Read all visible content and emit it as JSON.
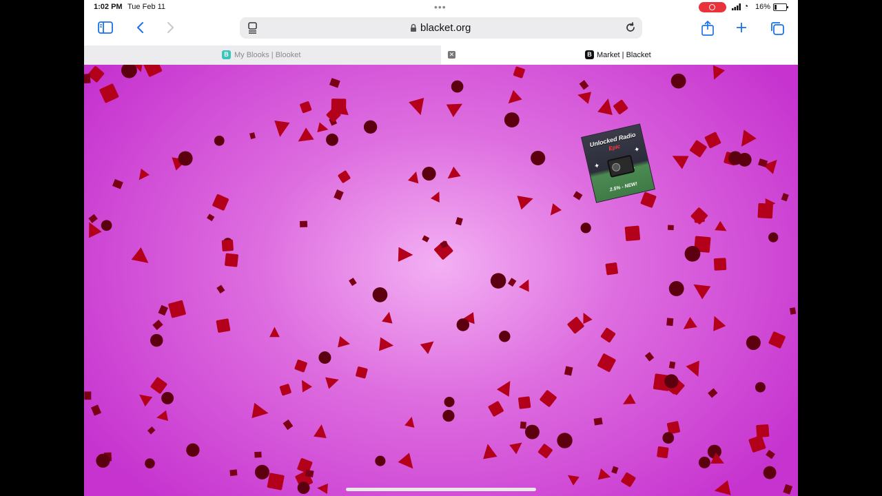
{
  "status_bar": {
    "time": "1:02 PM",
    "date": "Tue Feb 11",
    "battery_percent": "16%",
    "recording": true
  },
  "toolbar": {
    "url": "blacket.org",
    "icons": [
      "sidebar-icon",
      "back-icon",
      "forward-icon",
      "reader-icon",
      "lock-icon",
      "reload-icon",
      "share-icon",
      "new-tab-icon",
      "tabs-overview-icon"
    ]
  },
  "tabs": [
    {
      "label": "My Blooks | Blooket",
      "favicon": "B",
      "favicon_color": "#39c5bb",
      "active": false
    },
    {
      "label": "Market | Blacket",
      "favicon": "B",
      "favicon_color": "#111111",
      "active": true
    }
  ],
  "page": {
    "background_colors": {
      "center": "#f3b0f3",
      "edge": "#c633cf",
      "shape": "#b3001b"
    },
    "pack": {
      "title": "Unlocked Radio",
      "rarity": "Epic",
      "chance": "2.5% - NEW!"
    }
  }
}
